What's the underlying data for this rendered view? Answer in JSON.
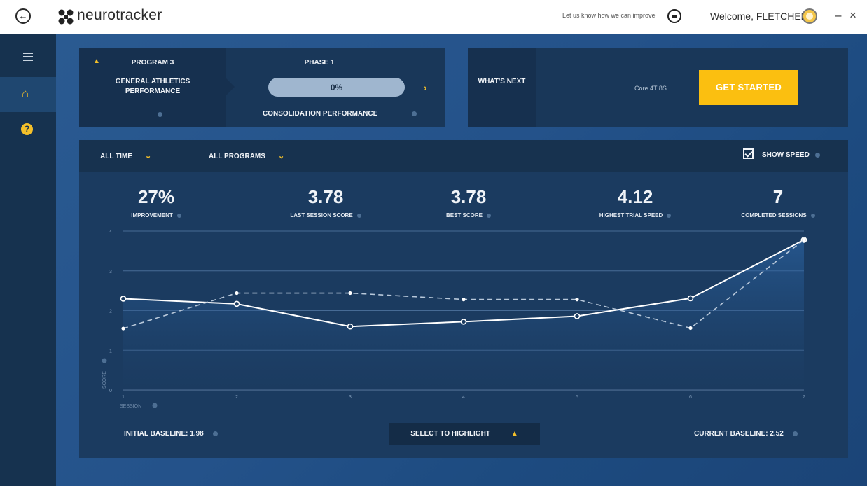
{
  "titlebar": {
    "brand": "neurotracker",
    "feedback": "Let us know how we can improve",
    "welcome": "Welcome, FLETCHER"
  },
  "program": {
    "number": "PROGRAM 3",
    "name": "GENERAL ATHLETICS PERFORMANCE",
    "phase": "PHASE 1",
    "progress_text": "0%",
    "progress_fraction": 0,
    "subtitle": "CONSOLIDATION PERFORMANCE"
  },
  "next": {
    "label": "WHAT'S NEXT",
    "core": "Core 4T 8S",
    "button": "GET STARTED"
  },
  "filters": {
    "time": "ALL TIME",
    "programs": "ALL PROGRAMS",
    "show_speed": "SHOW SPEED"
  },
  "stats": [
    {
      "value": "27%",
      "label": "IMPROVEMENT"
    },
    {
      "value": "3.78",
      "label": "LAST SESSION SCORE"
    },
    {
      "value": "3.78",
      "label": "BEST SCORE"
    },
    {
      "value": "4.12",
      "label": "HIGHEST TRIAL SPEED"
    },
    {
      "value": "7",
      "label": "COMPLETED SESSIONS"
    }
  ],
  "chart_data": {
    "type": "line",
    "x": [
      1,
      2,
      3,
      4,
      5,
      6,
      7
    ],
    "xlabel": "SESSION",
    "ylabel": "SCORE",
    "ylim": [
      0,
      4
    ],
    "y_ticks": [
      "0",
      "1",
      "2",
      "3",
      "4"
    ],
    "grid": true,
    "series": [
      {
        "values": [
          2.3,
          2.17,
          1.6,
          1.72,
          1.86,
          2.31,
          3.78
        ],
        "style": "solid",
        "color": "#ffffff"
      },
      {
        "values": [
          1.55,
          2.44,
          2.44,
          2.28,
          2.28,
          1.56,
          3.78
        ],
        "style": "dashed",
        "color": "#b8c8da"
      }
    ]
  },
  "footer": {
    "initial_baseline": "INITIAL BASELINE: 1.98",
    "select_highlight": "SELECT TO HIGHLIGHT",
    "current_baseline": "CURRENT BASELINE:  2.52"
  },
  "colors": {
    "accent": "#f4c02a",
    "button": "#fbbf10",
    "panel": "#193759",
    "sidebar": "#16324f"
  },
  "icons": {
    "back": "back-arrow-icon",
    "logo": "neurotracker-logo-icon",
    "feedback": "chat-icon",
    "menu": "hamburger-icon",
    "home": "home-icon",
    "help": "help-icon"
  }
}
